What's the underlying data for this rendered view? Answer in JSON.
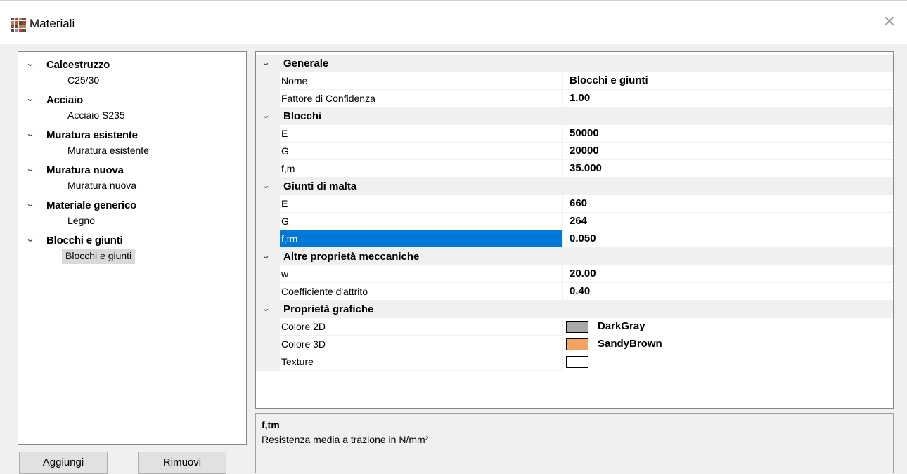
{
  "window": {
    "title": "Materiali",
    "close_glyph": "✕",
    "icon": "materials-app-icon"
  },
  "tree": {
    "expand_glyph": "⌄",
    "groups": [
      {
        "label": "Calcestruzzo",
        "children": [
          "C25/30"
        ]
      },
      {
        "label": "Acciaio",
        "children": [
          "Acciaio S235"
        ]
      },
      {
        "label": "Muratura esistente",
        "children": [
          "Muratura esistente"
        ]
      },
      {
        "label": "Muratura nuova",
        "children": [
          "Muratura nuova"
        ]
      },
      {
        "label": "Materiale generico",
        "children": [
          "Legno"
        ]
      },
      {
        "label": "Blocchi e giunti",
        "children": [
          "Blocchi e giunti"
        ]
      }
    ],
    "selected": "Blocchi e giunti"
  },
  "buttons": {
    "add": "Aggiungi",
    "remove": "Rimuovi"
  },
  "grid": {
    "categories": [
      {
        "label": "Generale",
        "props": [
          {
            "name": "Nome",
            "value": "Blocchi e giunti"
          },
          {
            "name": "Fattore di Confidenza",
            "value": "1.00"
          }
        ]
      },
      {
        "label": "Blocchi",
        "props": [
          {
            "name": "E",
            "value": "50000"
          },
          {
            "name": "G",
            "value": "20000"
          },
          {
            "name": "f,m",
            "value": "35.000"
          }
        ]
      },
      {
        "label": "Giunti di malta",
        "props": [
          {
            "name": "E",
            "value": "660"
          },
          {
            "name": "G",
            "value": "264"
          },
          {
            "name": "f,tm",
            "value": "0.050"
          }
        ]
      },
      {
        "label": "Altre proprietà meccaniche",
        "props": [
          {
            "name": "w",
            "value": "20.00"
          },
          {
            "name": "Coefficiente d'attrito",
            "value": "0.40"
          }
        ]
      },
      {
        "label": "Proprietà grafiche",
        "props": [
          {
            "name": "Colore 2D",
            "value": "DarkGray",
            "color": "#a9a9a9"
          },
          {
            "name": "Colore 3D",
            "value": "SandyBrown",
            "color": "#f4a460"
          },
          {
            "name": "Texture",
            "value": "",
            "color": "#ffffff"
          }
        ]
      }
    ],
    "selected_property": "f,tm"
  },
  "help": {
    "title": "f,tm",
    "description": "Resistenza media a trazione in N/mm²"
  },
  "colors": {
    "selection": "#0078d7",
    "tree_selection": "#d9d9d9"
  }
}
